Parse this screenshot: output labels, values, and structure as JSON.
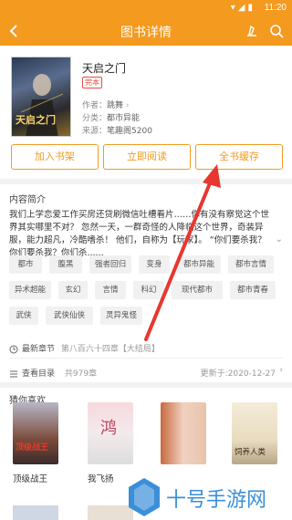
{
  "status_bar": {
    "time": "11:20"
  },
  "app_bar": {
    "title": "图书详情",
    "icons": [
      "back-arrow-icon",
      "brush-icon",
      "search-icon"
    ]
  },
  "book": {
    "title": "天启之门",
    "status_tag": "完本",
    "cover_text": "天启之门",
    "author_label": "作者：",
    "author": "跳舞",
    "category_label": "分类：",
    "category": "都市异能",
    "source_label": "来源：",
    "source": "笔趣阁5200"
  },
  "actions": {
    "add_shelf": "加入书架",
    "read_now": "立即阅读",
    "cache_all": "全书缓存"
  },
  "intro": {
    "heading": "内容简介",
    "text": "我们上学恋爱工作买房还贷刷微信吐槽看片……你有没有察觉这个世界其实哪里不对？ 忽然一天，一群奇怪的人降临这个世界，奇装异服，能力超凡，冷酷嗜杀！ 他们，自称为【玩家】。 “你们要杀我？你们要杀我？你们杀......"
  },
  "tags": [
    "都市",
    "腹黑",
    "强者回归",
    "变身",
    "都市异能",
    "都市言情",
    "异术超能",
    "玄幻",
    "言情",
    "科幻",
    "现代都市",
    "都市青春",
    "武侠",
    "武侠仙侠",
    "灵异鬼怪"
  ],
  "latest_chapter": {
    "label": "最新章节",
    "value": "第八百六十四章【大结局】"
  },
  "catalog": {
    "label": "查看目录",
    "count": "共979章",
    "updated": "更新于:2020-12-27"
  },
  "guess": {
    "heading": "猜你喜欢",
    "items": [
      {
        "name": "顶级战王",
        "cover_text": "顶级战王"
      },
      {
        "name": "我飞扬",
        "cover_text": "鸿"
      },
      {
        "name": "",
        "cover_text": ""
      },
      {
        "name": "",
        "cover_text": "饲养人类"
      }
    ]
  },
  "watermark": {
    "text": "十号手游网"
  },
  "colors": {
    "accent": "#f39a1f",
    "tag_red": "#e94b3c",
    "arrow_red": "#e8372f",
    "watermark_blue": "#3b8fd9"
  }
}
